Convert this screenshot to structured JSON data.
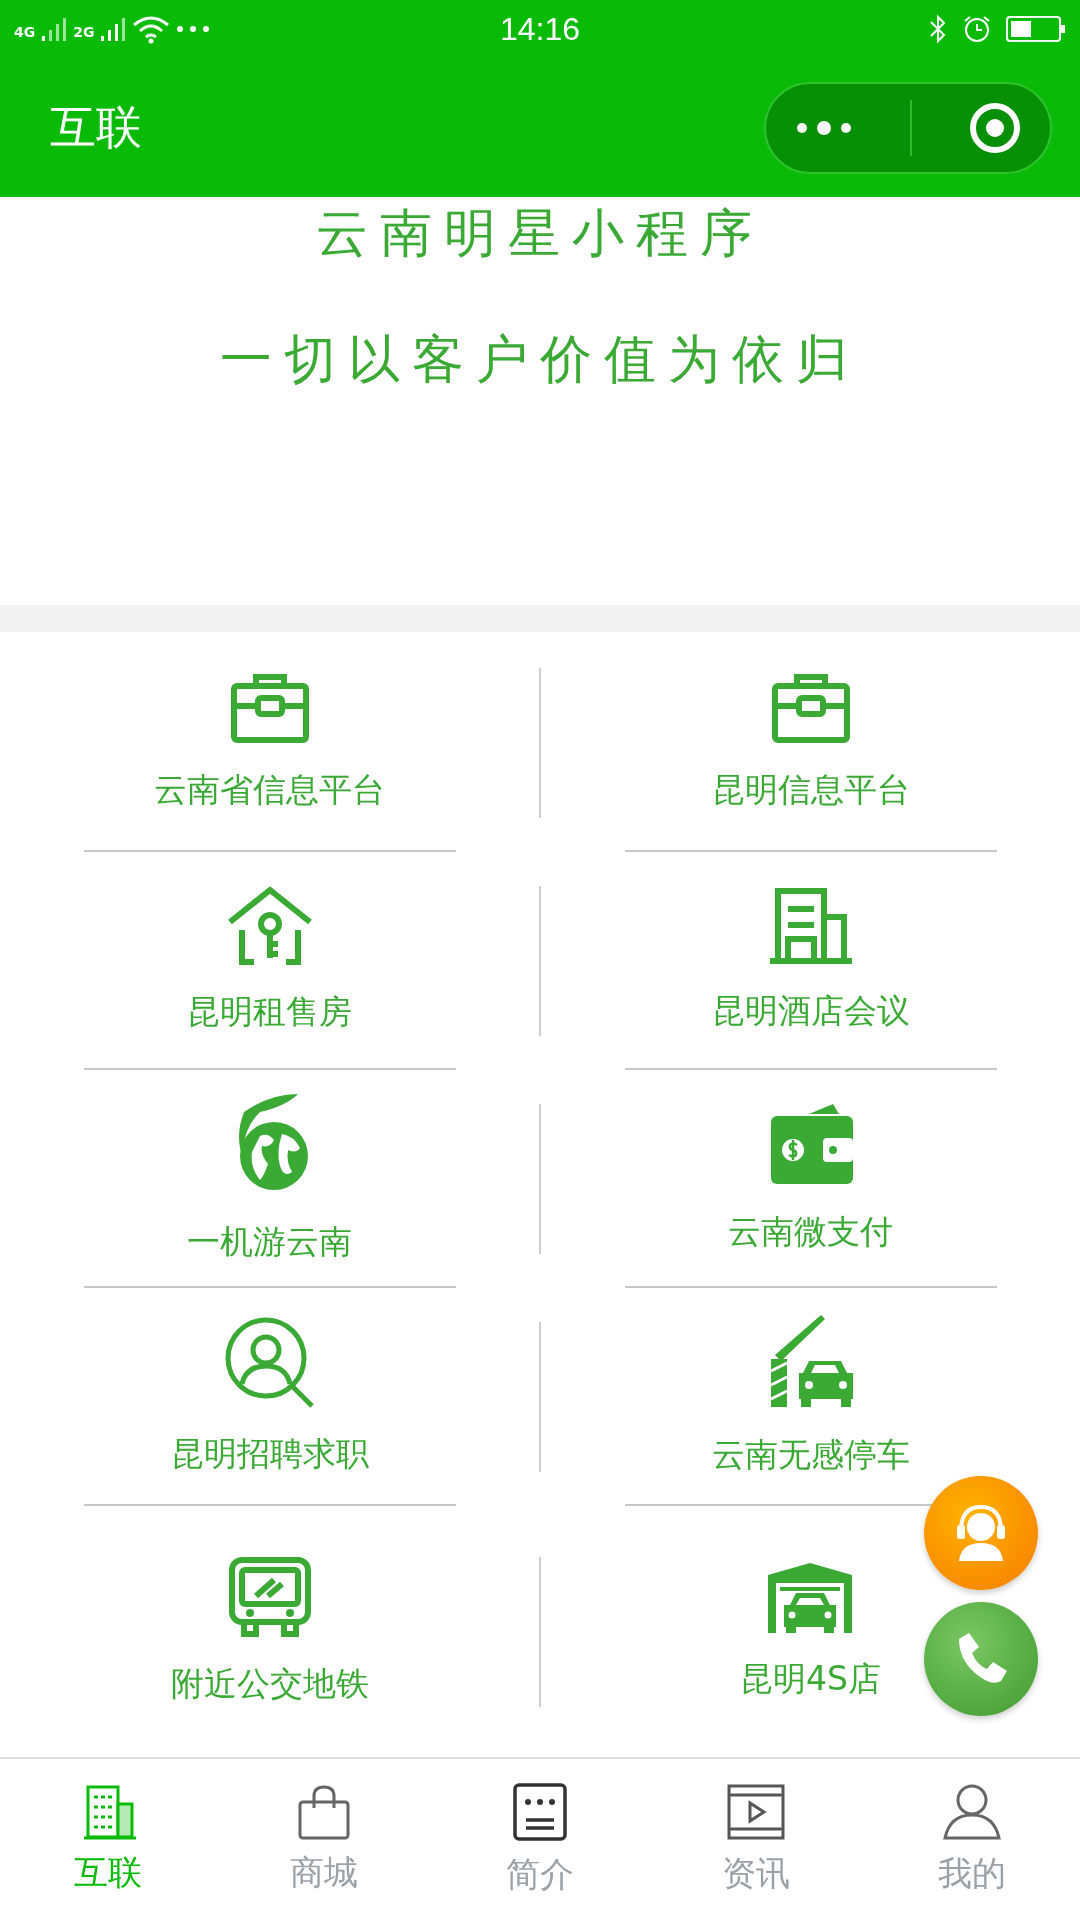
{
  "status_bar": {
    "network_1": "4G",
    "network_2": "2G",
    "time": "14:16"
  },
  "nav_bar": {
    "title": "互联"
  },
  "banner": {
    "title": "云南明星小程序",
    "slogan": "一切以客户价值为依归"
  },
  "grid": [
    {
      "label": "云南省信息平台"
    },
    {
      "label": "昆明信息平台"
    },
    {
      "label": "昆明租售房"
    },
    {
      "label": "昆明酒店会议"
    },
    {
      "label": "一机游云南"
    },
    {
      "label": "云南微支付"
    },
    {
      "label": "昆明招聘求职"
    },
    {
      "label": "云南无感停车"
    },
    {
      "label": "附近公交地铁"
    },
    {
      "label": "昆明4S店"
    }
  ],
  "tab_bar": [
    {
      "label": "互联",
      "selected": true
    },
    {
      "label": "商城",
      "selected": false
    },
    {
      "label": "简介",
      "selected": false
    },
    {
      "label": "资讯",
      "selected": false
    },
    {
      "label": "我的",
      "selected": false
    }
  ]
}
